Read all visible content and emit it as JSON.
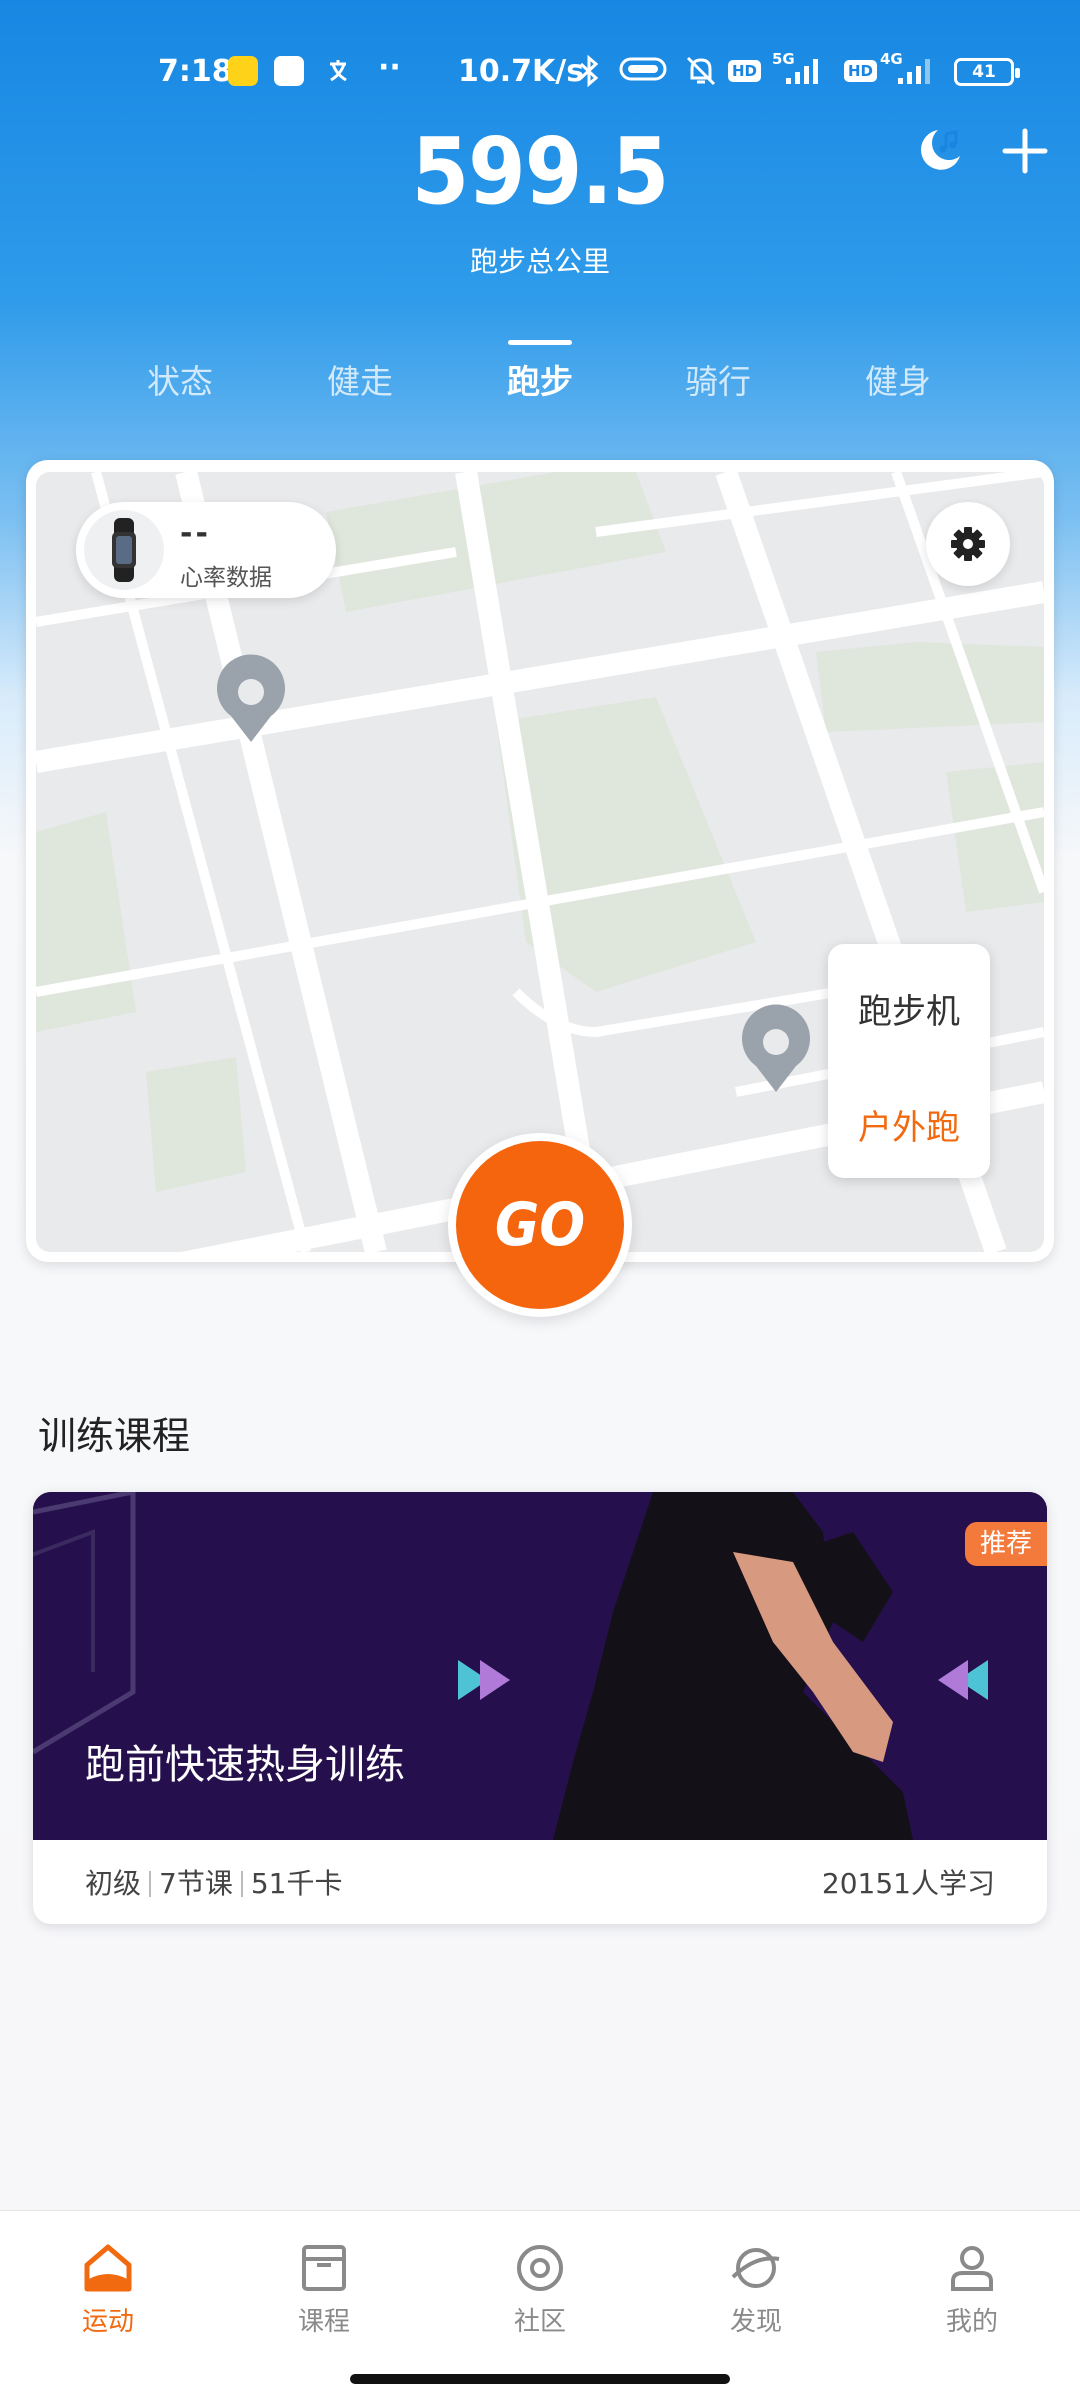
{
  "status_bar": {
    "time": "7:18",
    "dots": "··",
    "net_speed": "10.7K/s",
    "hd_badge": "HD",
    "net_5g": "5G",
    "net_4g": "4G",
    "battery": "41"
  },
  "header": {
    "total_distance": "599.5",
    "total_label": "跑步总公里"
  },
  "tabs": [
    {
      "label": "状态"
    },
    {
      "label": "健走"
    },
    {
      "label": "跑步",
      "active": true
    },
    {
      "label": "骑行"
    },
    {
      "label": "健身"
    }
  ],
  "map_card": {
    "heart_rate_value": "--",
    "heart_rate_label": "心率数据",
    "modes": {
      "treadmill": "跑步机",
      "outdoor": "户外跑"
    },
    "go_label": "GO"
  },
  "courses": {
    "section_title": "训练课程",
    "items": [
      {
        "title": "跑前快速热身训练",
        "badge": "推荐",
        "level": "初级",
        "lessons": "7节课",
        "calories": "51千卡",
        "learners": "20151人学习"
      }
    ]
  },
  "bottom_nav": [
    {
      "label": "运动",
      "icon": "home-icon",
      "active": true
    },
    {
      "label": "课程",
      "icon": "course-icon"
    },
    {
      "label": "社区",
      "icon": "community-icon"
    },
    {
      "label": "发现",
      "icon": "discover-icon"
    },
    {
      "label": "我的",
      "icon": "profile-icon"
    }
  ],
  "colors": {
    "accent": "#f26a10",
    "header_blue": "#1787e3",
    "banner_purple": "#25104d"
  }
}
